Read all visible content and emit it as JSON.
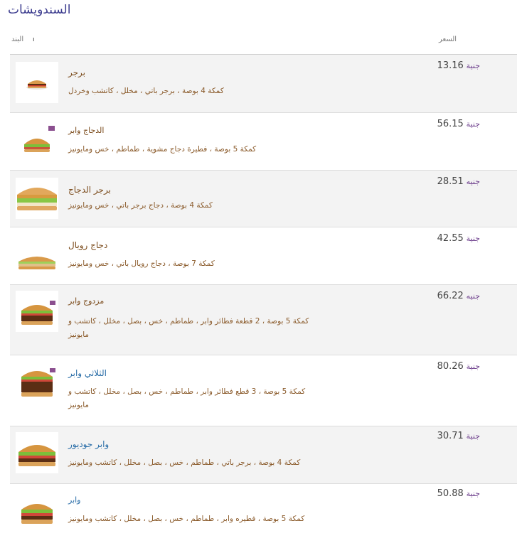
{
  "page": {
    "title": "السندويشات"
  },
  "columns": {
    "item": "البند",
    "item_mark": "ı",
    "price": "السعر"
  },
  "items": [
    {
      "name": "برجر",
      "desc": "كمكة 4 بوصة ، برجر باتي ، مخلل ، كاتشب وخردل",
      "price": "13.16",
      "currency": "جنية",
      "icon": "hamburger-small-image"
    },
    {
      "name": "الدجاج وابر",
      "desc": "كمكة 5 بوصة ، فطيرة دجاج مشوية ، طماطم ، خس ومايونيز",
      "price": "56.15",
      "currency": "جنية",
      "icon": "chicken-whopper-image"
    },
    {
      "name": "برجر الدجاج",
      "desc": "كمكة 4 بوصة ، دجاج برجر باتي ، خس ومايونيز",
      "price": "28.51",
      "currency": "جنيه",
      "icon": "chicken-burger-image"
    },
    {
      "name": "دجاج رويال",
      "desc": "كمكة 7 بوصة ، دجاج رويال باتي ، خس ومايونيز",
      "price": "42.55",
      "currency": "جنية",
      "icon": "chicken-royale-image"
    },
    {
      "name": "مزدوج وابر",
      "desc": "كمكة 5 بوصة ، 2 قطعة فطائر وابر ، طماطم ، خس ، بصل ، مخلل ، كاتشب و مايونيز",
      "price": "66.22",
      "currency": "جنيه",
      "icon": "double-whopper-image"
    },
    {
      "name": "الثلاثي وابر",
      "desc": "كمكة 5 بوصة ، 3 قطع فطائر وابر ، طماطم ، خس ، بصل ، مخلل ، كاتشب و مايونيز",
      "price": "80.26",
      "currency": "جنية",
      "icon": "triple-whopper-image"
    },
    {
      "name": "وابر جوديور",
      "desc": "كمكة 4 بوصة ، برجر باتي ، طماطم ، خس ، بصل ، مخلل ، كاتشب ومايونيز",
      "price": "30.71",
      "currency": "جنية",
      "icon": "whopper-jr-image"
    },
    {
      "name": "وابر",
      "desc": "كمكة 5 بوصة ، فطيره وابر ، طماطم ، خس ، بصل ، مخلل ، كاتشب ومايونيز",
      "price": "50.88",
      "currency": "جنية",
      "icon": "whopper-image"
    }
  ]
}
